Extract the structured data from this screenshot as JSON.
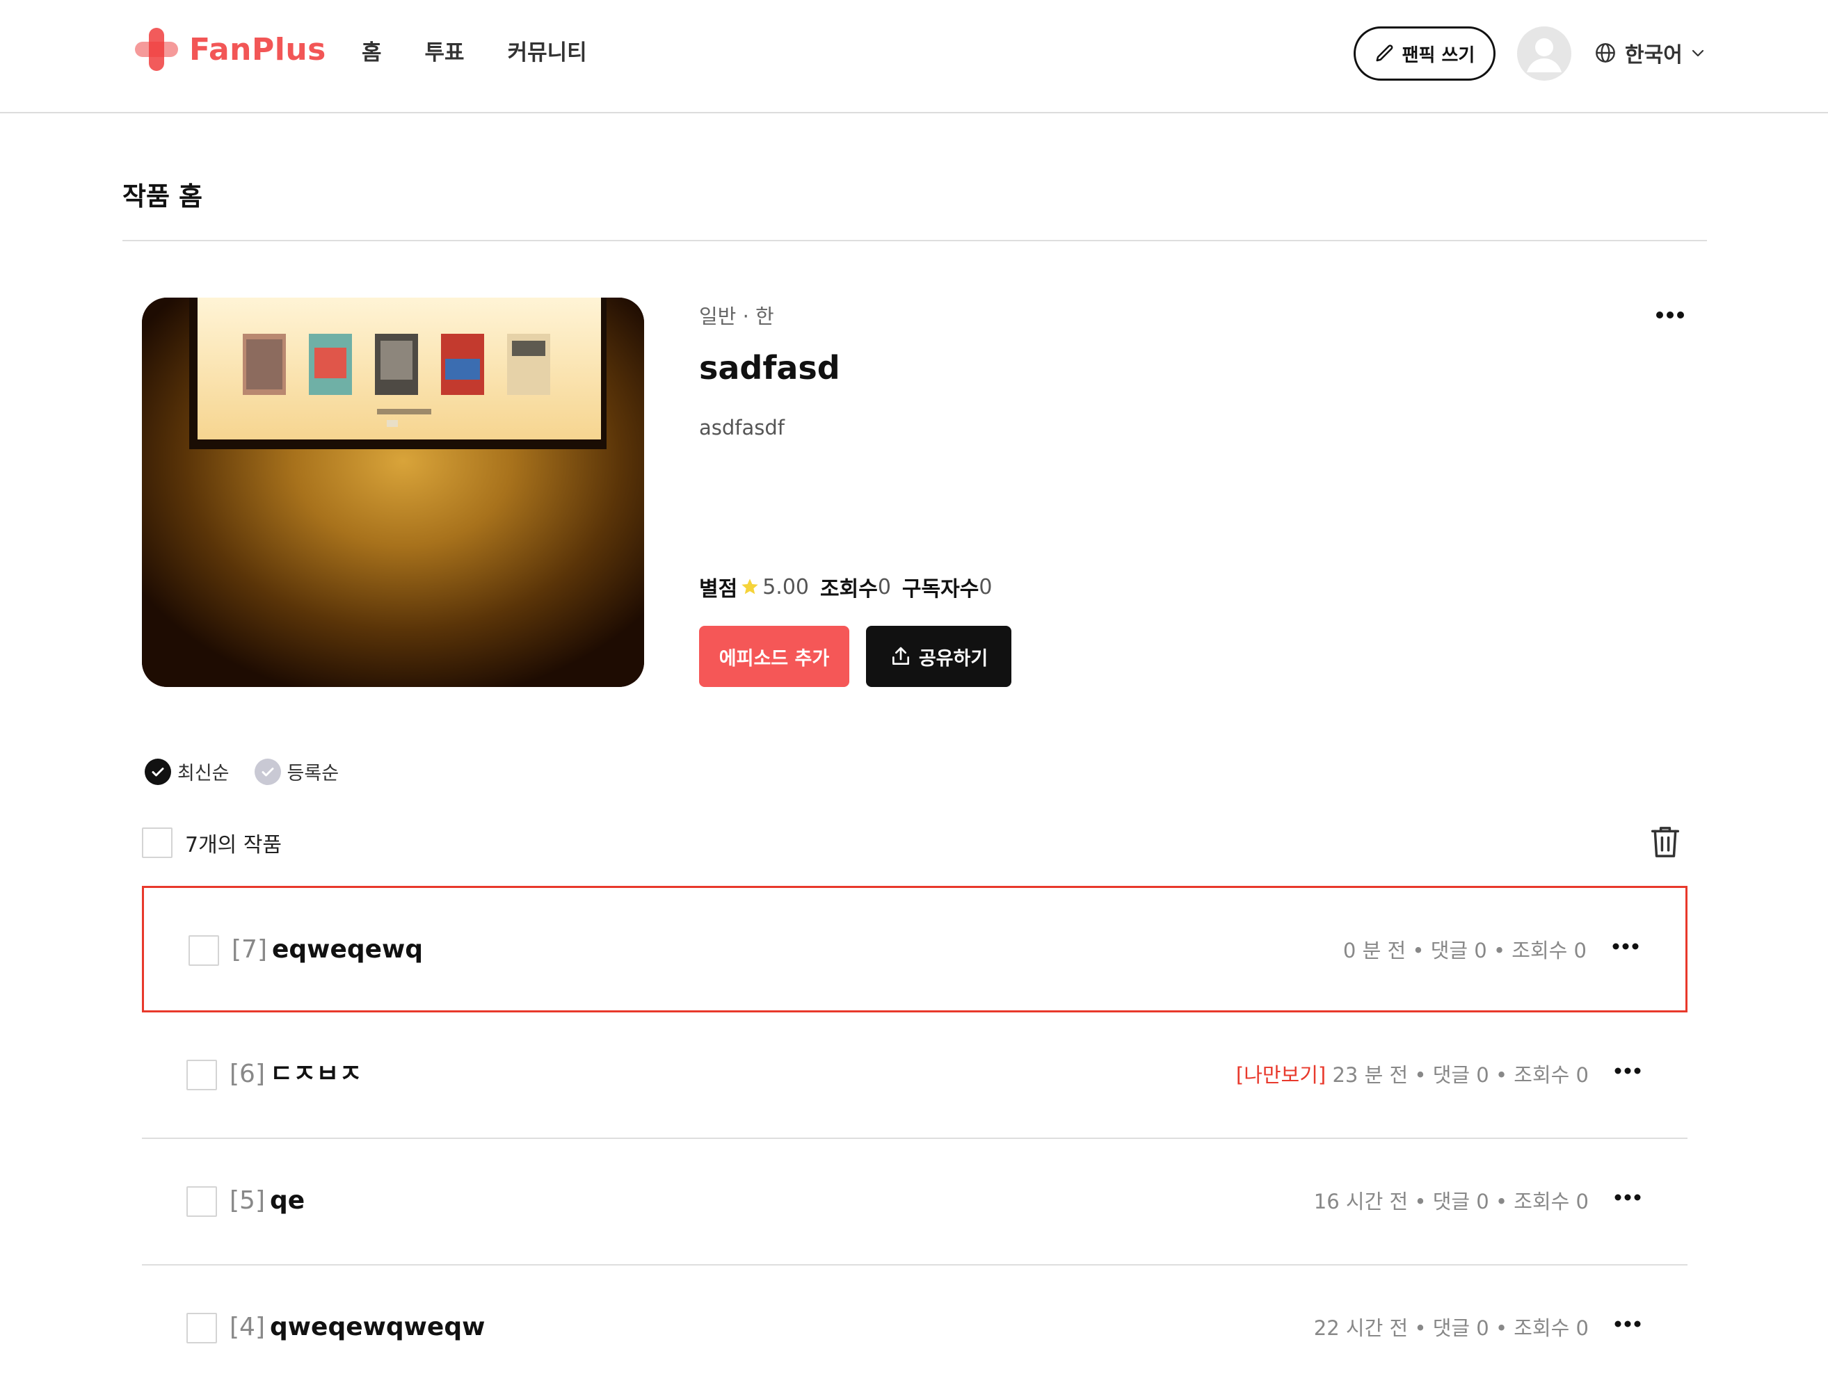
{
  "header": {
    "logo_text": "FanPlus",
    "nav": [
      "홈",
      "투표",
      "커뮤니티"
    ],
    "write_button": "팬픽 쓰기",
    "language": "한국어"
  },
  "page": {
    "title": "작품 홈"
  },
  "work": {
    "genre": "일반 · 한",
    "title": "sadfasd",
    "description": "asdfasdf",
    "stats": {
      "rating_label": "별점",
      "rating_value": "5.00",
      "views_label": "조회수",
      "views_value": "0",
      "subscribers_label": "구독자수",
      "subscribers_value": "0"
    },
    "add_episode_button": "에피소드 추가",
    "share_button": "공유하기"
  },
  "sort": {
    "options": [
      "최신순",
      "등록순"
    ],
    "selected": "최신순"
  },
  "list": {
    "count_label": "7개의 작품",
    "episodes": [
      {
        "num": "[7]",
        "title": "eqweqewq",
        "private": "",
        "time": "0 분 전",
        "comments": "댓글 0",
        "views": "조회수 0",
        "selected": true
      },
      {
        "num": "[6]",
        "title": "ㄷㅈㅂㅈ",
        "private": "[나만보기]",
        "time": "23 분 전",
        "comments": "댓글 0",
        "views": "조회수 0",
        "selected": false
      },
      {
        "num": "[5]",
        "title": "qe",
        "private": "",
        "time": "16 시간 전",
        "comments": "댓글 0",
        "views": "조회수 0",
        "selected": false
      },
      {
        "num": "[4]",
        "title": "qweqewqweqw",
        "private": "",
        "time": "22 시간 전",
        "comments": "댓글 0",
        "views": "조회수 0",
        "selected": false
      }
    ]
  },
  "colors": {
    "brand": "#f25656",
    "selected_border": "#e8392c",
    "private_text": "#e8392c",
    "star": "#f5d33a"
  },
  "icons": [
    "pencil-icon",
    "user-icon",
    "globe-icon",
    "chevron-down-icon",
    "more-icon",
    "star-icon",
    "share-icon",
    "check-icon",
    "trash-icon"
  ]
}
